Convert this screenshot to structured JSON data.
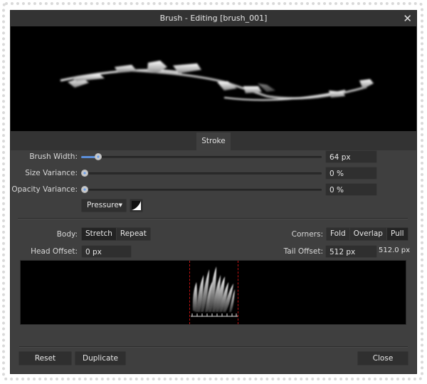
{
  "window": {
    "title": "Brush - Editing [brush_001]",
    "close_icon": "close-icon"
  },
  "tabs": [
    {
      "label": "Stroke",
      "active": true
    }
  ],
  "stroke": {
    "brush_width": {
      "label": "Brush Width:",
      "value": "64 px",
      "slider_fraction": 0.07
    },
    "size_variance": {
      "label": "Size Variance:",
      "value": "0 %",
      "slider_fraction": 0
    },
    "opacity_variance": {
      "label": "Opacity Variance:",
      "value": "0 %",
      "slider_fraction": 0
    },
    "controller": {
      "selected": "Pressure",
      "dropdown_icon": "triangle-down-icon",
      "curve_icon": "pressure-curve-icon"
    }
  },
  "texture": {
    "body": {
      "label": "Body:",
      "options": [
        "Stretch",
        "Repeat"
      ],
      "active": "Stretch"
    },
    "corners": {
      "label": "Corners:",
      "options": [
        "Fold",
        "Overlap",
        "Pull"
      ],
      "active": "Pull"
    },
    "head_offset": {
      "label": "Head Offset:",
      "value": "0 px"
    },
    "tail_offset": {
      "label": "Tail Offset:",
      "value": "512 px",
      "readout": "512.0 px"
    }
  },
  "footer": {
    "reset": "Reset",
    "duplicate": "Duplicate",
    "close": "Close"
  },
  "colors": {
    "accent": "#5b8ed8",
    "guide": "#c01010",
    "dialog_bg": "#3f3f3f"
  }
}
